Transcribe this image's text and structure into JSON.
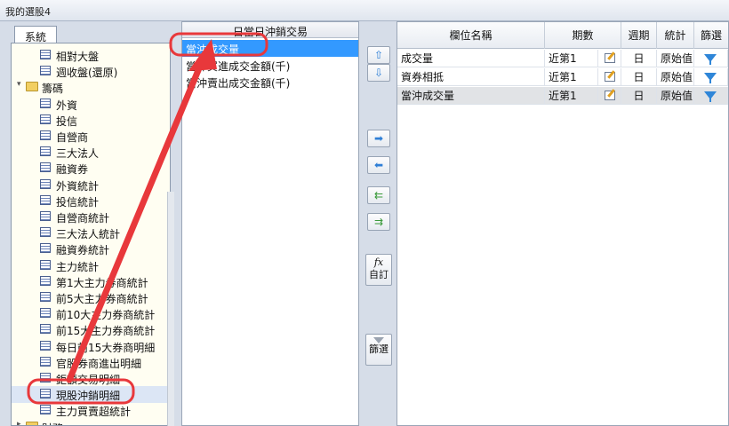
{
  "window": {
    "title": "我的選股4"
  },
  "tree": {
    "tab_label": "系統",
    "items": [
      {
        "label": "相對大盤",
        "kind": "leaf"
      },
      {
        "label": "週收盤(還原)",
        "kind": "leaf"
      },
      {
        "label": "籌碼",
        "kind": "folder-open"
      },
      {
        "label": "外資",
        "kind": "leaf"
      },
      {
        "label": "投信",
        "kind": "leaf"
      },
      {
        "label": "自營商",
        "kind": "leaf"
      },
      {
        "label": "三大法人",
        "kind": "leaf"
      },
      {
        "label": "融資券",
        "kind": "leaf"
      },
      {
        "label": "外資統計",
        "kind": "leaf"
      },
      {
        "label": "投信統計",
        "kind": "leaf"
      },
      {
        "label": "自營商統計",
        "kind": "leaf"
      },
      {
        "label": "三大法人統計",
        "kind": "leaf"
      },
      {
        "label": "融資券統計",
        "kind": "leaf"
      },
      {
        "label": "主力統計",
        "kind": "leaf"
      },
      {
        "label": "第1大主力券商統計",
        "kind": "leaf"
      },
      {
        "label": "前5大主力券商統計",
        "kind": "leaf"
      },
      {
        "label": "前10大主力券商統計",
        "kind": "leaf"
      },
      {
        "label": "前15大主力券商統計",
        "kind": "leaf"
      },
      {
        "label": "每日前15大券商明細",
        "kind": "leaf"
      },
      {
        "label": "官股券商進出明細",
        "kind": "leaf"
      },
      {
        "label": "鉅額交易明細",
        "kind": "leaf"
      },
      {
        "label": "現股沖銷明細",
        "kind": "leaf",
        "selected": true
      },
      {
        "label": "主力買賣超統計",
        "kind": "leaf"
      },
      {
        "label": "財務",
        "kind": "folder-closed"
      }
    ]
  },
  "middle": {
    "header": "日當日沖銷交易",
    "items": [
      {
        "label": "當沖成交量",
        "selected": true
      },
      {
        "label": "當沖買進成交金額(千)"
      },
      {
        "label": "當沖賣出成交金額(千)"
      }
    ]
  },
  "buttons": {
    "up": "⇧",
    "down": "⇩",
    "add": "➡",
    "remove": "⬅",
    "remove_all": "⇇",
    "add_all": "⇉",
    "custom_fx": "fx",
    "custom_label": "自訂",
    "filter_label": "篩選"
  },
  "grid": {
    "headers": [
      "欄位名稱",
      "期數",
      "週期",
      "統計",
      "篩選"
    ],
    "rows": [
      {
        "name": "成交量",
        "period": "近第1",
        "cycle": "日",
        "stat": "原始值"
      },
      {
        "name": "資券相抵",
        "period": "近第1",
        "cycle": "日",
        "stat": "原始值"
      },
      {
        "name": "當沖成交量",
        "period": "近第1",
        "cycle": "日",
        "stat": "原始值",
        "selected": true
      }
    ]
  },
  "colors": {
    "annotation": "#e8383b",
    "selection": "#3399ff"
  }
}
